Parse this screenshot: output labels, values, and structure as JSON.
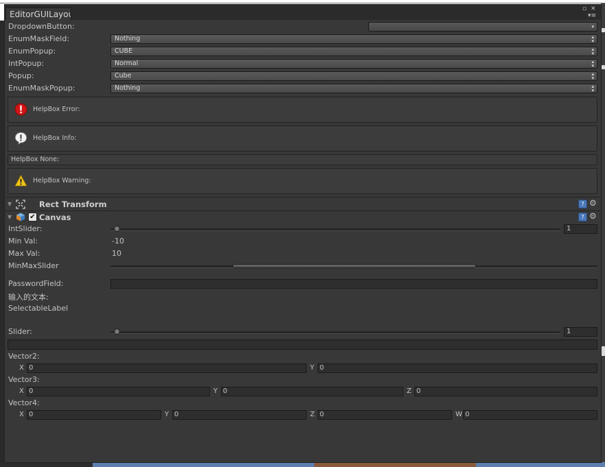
{
  "window": {
    "tab_title": "EditorGUILayou",
    "controls": {
      "maximize": "▫",
      "close": "✕",
      "menu": "▾≡"
    }
  },
  "popups": {
    "dropdown_button": {
      "label": "DropdownButton:",
      "value": ""
    },
    "enum_mask_field": {
      "label": "EnumMaskField:",
      "value": "Nothing"
    },
    "enum_popup": {
      "label": "EnumPopup:",
      "value": "CUBE"
    },
    "int_popup": {
      "label": "IntPopup:",
      "value": "Normal"
    },
    "popup": {
      "label": "Popup:",
      "value": "Cube"
    },
    "enum_mask_popup": {
      "label": "EnumMaskPopup:",
      "value": "Nothing"
    }
  },
  "helpboxes": {
    "error": "HelpBox Error:",
    "info": "HelpBox Info:",
    "none": "HelpBox None:",
    "warning": "HelpBox Warning:"
  },
  "components": {
    "rect_transform": {
      "title": "Rect Transform"
    },
    "canvas": {
      "title": "Canvas",
      "enabled": true
    }
  },
  "int_slider": {
    "label": "IntSlider:",
    "value": "1",
    "min": 0,
    "max": 100
  },
  "min_val": {
    "label": "Min Val:",
    "value": "-10"
  },
  "max_val": {
    "label": "Max Val:",
    "value": "10"
  },
  "minmax_slider": {
    "label": "MinMaxSlider",
    "range_start": 0.25,
    "range_end": 0.75
  },
  "password_field": {
    "label": "PasswordField:",
    "value": ""
  },
  "input_text_label": "输入的文本:",
  "selectable_label": "SelectableLabel",
  "slider": {
    "label": "Slider:",
    "value": "1",
    "min": 0,
    "max": 100
  },
  "vector2": {
    "label": "Vector2:",
    "axes": [
      "X",
      "Y"
    ],
    "values": [
      "0",
      "0"
    ]
  },
  "vector3": {
    "label": "Vector3:",
    "axes": [
      "X",
      "Y",
      "Z"
    ],
    "values": [
      "0",
      "0",
      "0"
    ]
  },
  "vector4": {
    "label": "Vector4:",
    "axes": [
      "X",
      "Y",
      "Z",
      "W"
    ],
    "values": [
      "0",
      "0",
      "0",
      "0"
    ]
  },
  "colors": {
    "panel": "#383838",
    "field": "#2e2e2e",
    "text": "#c4c4c4",
    "help_icon": "#4a78b8",
    "error_icon": "#d01515",
    "warning_icon": "#f0c419"
  }
}
